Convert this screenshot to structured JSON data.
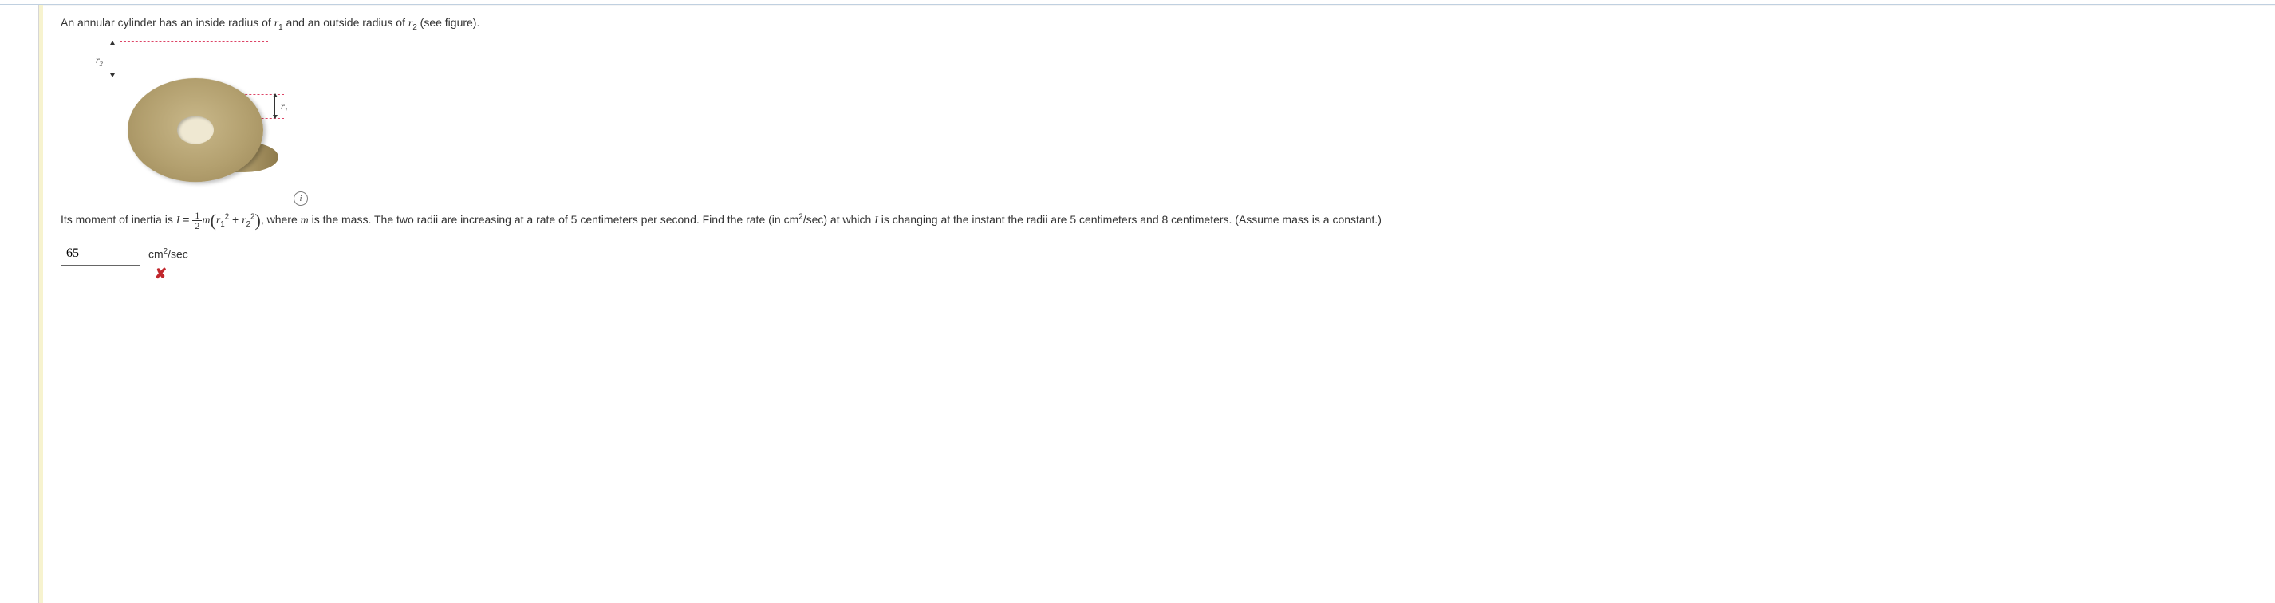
{
  "problem": {
    "intro_prefix": "An annular cylinder has an inside radius of ",
    "intro_mid": " and an outside radius of ",
    "intro_suffix": " (see figure).",
    "r1": "r",
    "r1_sub": "1",
    "r2": "r",
    "r2_sub": "2"
  },
  "figure": {
    "r1_label": "r",
    "r1_sub": "1",
    "r2_label": "r",
    "r2_sub": "2",
    "info_glyph": "i"
  },
  "inertia": {
    "lead": "Its moment of inertia is ",
    "I": "I",
    "equals": " = ",
    "frac_num": "1",
    "frac_den": "2",
    "m": "m",
    "open_paren": "(",
    "r1": "r",
    "r1_sub": "1",
    "plus": " + ",
    "r2": "r",
    "r2_sub": "2",
    "close_paren": ")",
    "comma_where_prefix": ", where ",
    "m2": "m",
    "tail1": " is the mass. The two radii are increasing at a rate of 5 centimeters per second. Find the rate (in cm",
    "tail_sup": "2",
    "tail2": "/sec) at which ",
    "I2": "I",
    "tail3": " is changing at the instant the radii are 5 centimeters and 8 centimeters. (Assume mass is a constant.)"
  },
  "answer": {
    "value": "65",
    "unit_prefix": "cm",
    "unit_sup": "2",
    "unit_suffix": "/sec",
    "wrong_mark": "✘"
  }
}
